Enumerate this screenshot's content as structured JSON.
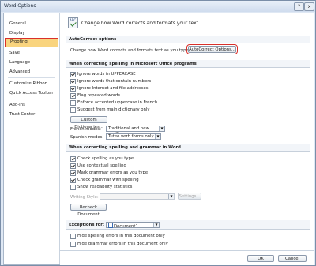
{
  "window": {
    "title": "Word Options",
    "help": "?",
    "close": "x"
  },
  "sidebar": {
    "items": [
      {
        "label": "General"
      },
      {
        "label": "Display"
      },
      {
        "label": "Proofing"
      },
      {
        "label": "Save"
      },
      {
        "label": "Language"
      },
      {
        "label": "Advanced"
      },
      {
        "label": "Customize Ribbon"
      },
      {
        "label": "Quick Access Toolbar"
      },
      {
        "label": "Add-Ins"
      },
      {
        "label": "Trust Center"
      }
    ],
    "selected": "Proofing"
  },
  "header": {
    "icon_text": "ABC",
    "text": "Change how Word corrects and formats your text."
  },
  "autocorrect": {
    "title": "AutoCorrect options",
    "description": "Change how Word corrects and formats text as you type:",
    "button": "AutoCorrect Options..."
  },
  "spelling_office": {
    "title": "When correcting spelling in Microsoft Office programs",
    "options": [
      {
        "label": "Ignore words in UPPERCASE",
        "checked": true
      },
      {
        "label": "Ignore words that contain numbers",
        "checked": true
      },
      {
        "label": "Ignore Internet and file addresses",
        "checked": true
      },
      {
        "label": "Flag repeated words",
        "checked": true
      },
      {
        "label": "Enforce accented uppercase in French",
        "checked": false
      },
      {
        "label": "Suggest from main dictionary only",
        "checked": false
      }
    ],
    "custom_dict_button": "Custom Dictionaries...",
    "french_label": "French modes:",
    "french_value": "Traditional and new spellings",
    "spanish_label": "Spanish modes:",
    "spanish_value": "Tuteo verb forms only"
  },
  "spelling_word": {
    "title": "When correcting spelling and grammar in Word",
    "options": [
      {
        "label": "Check spelling as you type",
        "checked": true
      },
      {
        "label": "Use contextual spelling",
        "checked": true
      },
      {
        "label": "Mark grammar errors as you type",
        "checked": true
      },
      {
        "label": "Check grammar with spelling",
        "checked": true
      },
      {
        "label": "Show readability statistics",
        "checked": false
      }
    ],
    "writing_style_label": "Writing Style:",
    "settings_button": "Settings...",
    "recheck_button": "Recheck Document"
  },
  "exceptions": {
    "label": "Exceptions for:",
    "value": "Document1",
    "options": [
      {
        "label": "Hide spelling errors in this document only",
        "checked": false
      },
      {
        "label": "Hide grammar errors in this document only",
        "checked": false
      }
    ]
  },
  "footer": {
    "ok": "OK",
    "cancel": "Cancel"
  },
  "colors": {
    "selected_nav": "#f9d47e",
    "highlight_outline": "#d9302a",
    "frame": "#dfe8f4"
  }
}
